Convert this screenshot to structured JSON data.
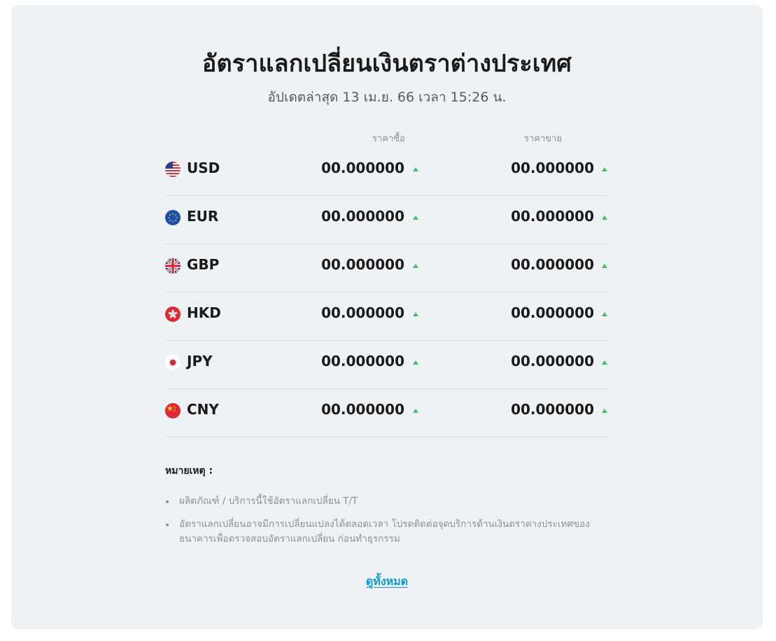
{
  "page": {
    "title": "อัตราแลกเปลี่ยนเงินตราต่างประเทศ",
    "updated": "อัปเดตล่าสุด 13 เม.ย. 66 เวลา 15:26 น."
  },
  "table": {
    "headers": {
      "buy": "ราคาซื้อ",
      "sell": "ราคาขาย"
    },
    "rows": [
      {
        "code": "USD",
        "flag": "us-flag-icon",
        "buy": "00.000000",
        "sell": "00.000000",
        "buy_trend": "up",
        "sell_trend": "up"
      },
      {
        "code": "EUR",
        "flag": "eu-flag-icon",
        "buy": "00.000000",
        "sell": "00.000000",
        "buy_trend": "up",
        "sell_trend": "up"
      },
      {
        "code": "GBP",
        "flag": "gb-flag-icon",
        "buy": "00.000000",
        "sell": "00.000000",
        "buy_trend": "up",
        "sell_trend": "up"
      },
      {
        "code": "HKD",
        "flag": "hk-flag-icon",
        "buy": "00.000000",
        "sell": "00.000000",
        "buy_trend": "up",
        "sell_trend": "up"
      },
      {
        "code": "JPY",
        "flag": "jp-flag-icon",
        "buy": "00.000000",
        "sell": "00.000000",
        "buy_trend": "up",
        "sell_trend": "up"
      },
      {
        "code": "CNY",
        "flag": "cn-flag-icon",
        "buy": "00.000000",
        "sell": "00.000000",
        "buy_trend": "up",
        "sell_trend": "up"
      }
    ]
  },
  "notes": {
    "title": "หมายเหตุ :",
    "items": [
      "ผลิตภัณฑ์ / บริการนี้ใช้อัตราแลกเปลี่ยน T/T",
      "อัตราแลกเปลี่ยนอาจมีการเปลี่ยนแปลงได้ตลอดเวลา โปรดติดต่อจุดบริการด้านเงินตราต่างประเทศของธนาคารเพื่อตรวจสอบอัตราแลกเปลี่ยน ก่อนทำธุรกรรม"
    ]
  },
  "view_all": {
    "label": "ดูทั้งหมด"
  },
  "colors": {
    "card_bg": "#eff2f5",
    "trend_up": "#3cc363",
    "link": "#0a9bd6"
  }
}
